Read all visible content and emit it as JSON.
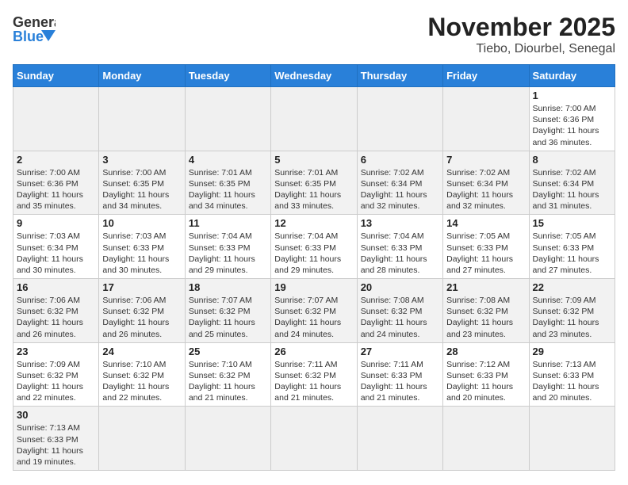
{
  "header": {
    "logo_general": "General",
    "logo_blue": "Blue",
    "title": "November 2025",
    "subtitle": "Tiebo, Diourbel, Senegal"
  },
  "weekdays": [
    "Sunday",
    "Monday",
    "Tuesday",
    "Wednesday",
    "Thursday",
    "Friday",
    "Saturday"
  ],
  "weeks": [
    [
      {
        "day": "",
        "info": ""
      },
      {
        "day": "",
        "info": ""
      },
      {
        "day": "",
        "info": ""
      },
      {
        "day": "",
        "info": ""
      },
      {
        "day": "",
        "info": ""
      },
      {
        "day": "",
        "info": ""
      },
      {
        "day": "1",
        "info": "Sunrise: 7:00 AM\nSunset: 6:36 PM\nDaylight: 11 hours\nand 36 minutes."
      }
    ],
    [
      {
        "day": "2",
        "info": "Sunrise: 7:00 AM\nSunset: 6:36 PM\nDaylight: 11 hours\nand 35 minutes."
      },
      {
        "day": "3",
        "info": "Sunrise: 7:00 AM\nSunset: 6:35 PM\nDaylight: 11 hours\nand 34 minutes."
      },
      {
        "day": "4",
        "info": "Sunrise: 7:01 AM\nSunset: 6:35 PM\nDaylight: 11 hours\nand 34 minutes."
      },
      {
        "day": "5",
        "info": "Sunrise: 7:01 AM\nSunset: 6:35 PM\nDaylight: 11 hours\nand 33 minutes."
      },
      {
        "day": "6",
        "info": "Sunrise: 7:02 AM\nSunset: 6:34 PM\nDaylight: 11 hours\nand 32 minutes."
      },
      {
        "day": "7",
        "info": "Sunrise: 7:02 AM\nSunset: 6:34 PM\nDaylight: 11 hours\nand 32 minutes."
      },
      {
        "day": "8",
        "info": "Sunrise: 7:02 AM\nSunset: 6:34 PM\nDaylight: 11 hours\nand 31 minutes."
      }
    ],
    [
      {
        "day": "9",
        "info": "Sunrise: 7:03 AM\nSunset: 6:34 PM\nDaylight: 11 hours\nand 30 minutes."
      },
      {
        "day": "10",
        "info": "Sunrise: 7:03 AM\nSunset: 6:33 PM\nDaylight: 11 hours\nand 30 minutes."
      },
      {
        "day": "11",
        "info": "Sunrise: 7:04 AM\nSunset: 6:33 PM\nDaylight: 11 hours\nand 29 minutes."
      },
      {
        "day": "12",
        "info": "Sunrise: 7:04 AM\nSunset: 6:33 PM\nDaylight: 11 hours\nand 29 minutes."
      },
      {
        "day": "13",
        "info": "Sunrise: 7:04 AM\nSunset: 6:33 PM\nDaylight: 11 hours\nand 28 minutes."
      },
      {
        "day": "14",
        "info": "Sunrise: 7:05 AM\nSunset: 6:33 PM\nDaylight: 11 hours\nand 27 minutes."
      },
      {
        "day": "15",
        "info": "Sunrise: 7:05 AM\nSunset: 6:33 PM\nDaylight: 11 hours\nand 27 minutes."
      }
    ],
    [
      {
        "day": "16",
        "info": "Sunrise: 7:06 AM\nSunset: 6:32 PM\nDaylight: 11 hours\nand 26 minutes."
      },
      {
        "day": "17",
        "info": "Sunrise: 7:06 AM\nSunset: 6:32 PM\nDaylight: 11 hours\nand 26 minutes."
      },
      {
        "day": "18",
        "info": "Sunrise: 7:07 AM\nSunset: 6:32 PM\nDaylight: 11 hours\nand 25 minutes."
      },
      {
        "day": "19",
        "info": "Sunrise: 7:07 AM\nSunset: 6:32 PM\nDaylight: 11 hours\nand 24 minutes."
      },
      {
        "day": "20",
        "info": "Sunrise: 7:08 AM\nSunset: 6:32 PM\nDaylight: 11 hours\nand 24 minutes."
      },
      {
        "day": "21",
        "info": "Sunrise: 7:08 AM\nSunset: 6:32 PM\nDaylight: 11 hours\nand 23 minutes."
      },
      {
        "day": "22",
        "info": "Sunrise: 7:09 AM\nSunset: 6:32 PM\nDaylight: 11 hours\nand 23 minutes."
      }
    ],
    [
      {
        "day": "23",
        "info": "Sunrise: 7:09 AM\nSunset: 6:32 PM\nDaylight: 11 hours\nand 22 minutes."
      },
      {
        "day": "24",
        "info": "Sunrise: 7:10 AM\nSunset: 6:32 PM\nDaylight: 11 hours\nand 22 minutes."
      },
      {
        "day": "25",
        "info": "Sunrise: 7:10 AM\nSunset: 6:32 PM\nDaylight: 11 hours\nand 21 minutes."
      },
      {
        "day": "26",
        "info": "Sunrise: 7:11 AM\nSunset: 6:32 PM\nDaylight: 11 hours\nand 21 minutes."
      },
      {
        "day": "27",
        "info": "Sunrise: 7:11 AM\nSunset: 6:33 PM\nDaylight: 11 hours\nand 21 minutes."
      },
      {
        "day": "28",
        "info": "Sunrise: 7:12 AM\nSunset: 6:33 PM\nDaylight: 11 hours\nand 20 minutes."
      },
      {
        "day": "29",
        "info": "Sunrise: 7:13 AM\nSunset: 6:33 PM\nDaylight: 11 hours\nand 20 minutes."
      }
    ],
    [
      {
        "day": "30",
        "info": "Sunrise: 7:13 AM\nSunset: 6:33 PM\nDaylight: 11 hours\nand 19 minutes."
      },
      {
        "day": "",
        "info": ""
      },
      {
        "day": "",
        "info": ""
      },
      {
        "day": "",
        "info": ""
      },
      {
        "day": "",
        "info": ""
      },
      {
        "day": "",
        "info": ""
      },
      {
        "day": "",
        "info": ""
      }
    ]
  ]
}
